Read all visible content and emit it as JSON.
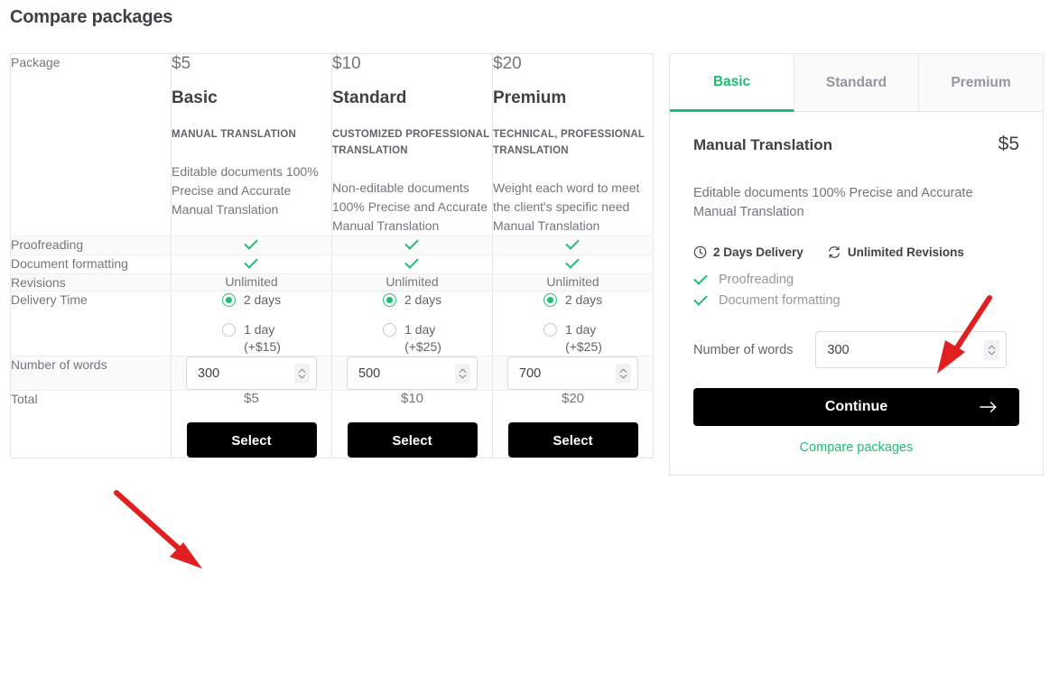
{
  "page_title": "Compare packages",
  "accent_green": "#1dbf73",
  "annotation_color": "#e02020",
  "table": {
    "row_labels": {
      "package": "Package",
      "proofreading": "Proofreading",
      "document_formatting": "Document formatting",
      "revisions": "Revisions",
      "delivery_time": "Delivery Time",
      "number_of_words": "Number of words",
      "total": "Total"
    },
    "packages": [
      {
        "price": "$5",
        "name": "Basic",
        "subtitle": "MANUAL TRANSLATION",
        "description": "Editable documents 100% Precise and Accurate Manual Translation",
        "proofreading": "check",
        "document_formatting": "check",
        "revisions": "Unlimited",
        "delivery_options": [
          {
            "label": "2 days",
            "extra": "",
            "selected": true
          },
          {
            "label": "1 day",
            "extra": "(+$15)",
            "selected": false
          }
        ],
        "number_of_words": "300",
        "total": "$5",
        "select_label": "Select"
      },
      {
        "price": "$10",
        "name": "Standard",
        "subtitle": "CUSTOMIZED PROFESSIONAL TRANSLATION",
        "description": "Non-editable documents   100% Precise and Accurate Manual Translation",
        "proofreading": "check",
        "document_formatting": "check",
        "revisions": "Unlimited",
        "delivery_options": [
          {
            "label": "2 days",
            "extra": "",
            "selected": true
          },
          {
            "label": "1 day",
            "extra": "(+$25)",
            "selected": false
          }
        ],
        "number_of_words": "500",
        "total": "$10",
        "select_label": "Select"
      },
      {
        "price": "$20",
        "name": "Premium",
        "subtitle": "TECHNICAL, PROFESSIONAL TRANSLATION",
        "description": "Weight each word to meet the client's specific need Manual Translation",
        "proofreading": "check",
        "document_formatting": "check",
        "revisions": "Unlimited",
        "delivery_options": [
          {
            "label": "2 days",
            "extra": "",
            "selected": true
          },
          {
            "label": "1 day",
            "extra": "(+$25)",
            "selected": false
          }
        ],
        "number_of_words": "700",
        "total": "$20",
        "select_label": "Select"
      }
    ]
  },
  "sidebar": {
    "tabs": [
      {
        "label": "Basic",
        "active": true
      },
      {
        "label": "Standard",
        "active": false
      },
      {
        "label": "Premium",
        "active": false
      }
    ],
    "title": "Manual Translation",
    "price": "$5",
    "description": "Editable documents  100% Precise and Accurate Manual Translation",
    "delivery": "2 Days Delivery",
    "revisions": "Unlimited Revisions",
    "features": [
      "Proofreading",
      "Document formatting"
    ],
    "words_label": "Number of words",
    "words_value": "300",
    "continue_label": "Continue",
    "compare_link": "Compare packages"
  }
}
